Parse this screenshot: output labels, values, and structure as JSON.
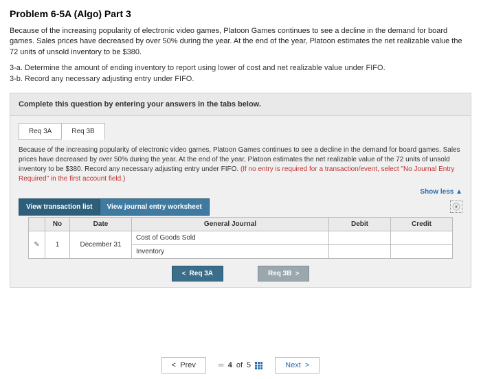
{
  "title": "Problem 6-5A (Algo) Part 3",
  "problem_text": "Because of the increasing popularity of electronic video games, Platoon Games continues to see a decline in the demand for board games. Sales prices have decreased by over 50% during the year. At the end of the year, Platoon estimates the net realizable value the 72 units of unsold inventory to be $380.",
  "parts": {
    "a": "3-a. Determine the amount of ending inventory to report using lower of cost and net realizable value under FIFO.",
    "b": "3-b. Record any necessary adjusting entry under FIFO."
  },
  "instruction": "Complete this question by entering your answers in the tabs below.",
  "tabs": [
    {
      "label": "Req 3A"
    },
    {
      "label": "Req 3B"
    }
  ],
  "subtext_black": "Because of the increasing popularity of electronic video games, Platoon Games continues to see a decline in the demand for board games. Sales prices have decreased by over 50% during the year. At the end of the year, Platoon estimates the net realizable value of the 72 units of unsold inventory to be $380. Record any necessary adjusting entry under FIFO. ",
  "subtext_red": "(If no entry is required for a transaction/event, select \"No Journal Entry Required\" in the first account field.)",
  "show_less": "Show less",
  "subtabs": [
    {
      "label": "View transaction list"
    },
    {
      "label": "View journal entry worksheet"
    }
  ],
  "close_x": "ⓧ",
  "headers": {
    "no": "No",
    "date": "Date",
    "gj": "General Journal",
    "debit": "Debit",
    "credit": "Credit"
  },
  "rows": [
    {
      "no": "1",
      "date": "December 31",
      "account": "Cost of Goods Sold",
      "debit": "",
      "credit": ""
    },
    {
      "no": "",
      "date": "",
      "account": "Inventory",
      "debit": "",
      "credit": ""
    }
  ],
  "pencil": "✎",
  "nav": {
    "prev_tab": "Req 3A",
    "next_tab": "Req 3B"
  },
  "footer": {
    "prev": "Prev",
    "link": "∞",
    "current": "4",
    "of": "of",
    "total": "5",
    "next": "Next"
  }
}
